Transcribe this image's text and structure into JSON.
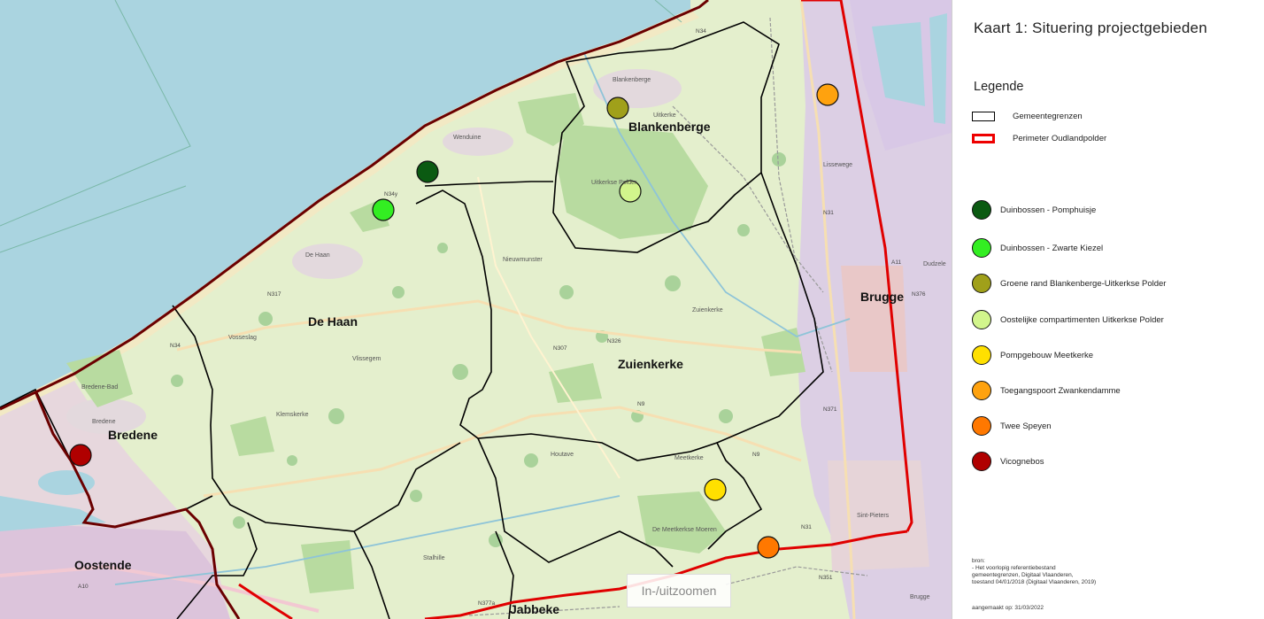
{
  "map": {
    "places": {
      "blankenberge": "Blankenberge",
      "de_haan": "De Haan",
      "zuienkerke": "Zuienkerke",
      "bredene": "Bredene",
      "brugge": "Brugge",
      "oostende": "Oostende",
      "jabbeke": "Jabbeke"
    },
    "small_labels": {
      "wenduine": "Wenduine",
      "uitkerke": "Uitkerke",
      "de_haan_small": "De Haan",
      "nieuwmunster": "Nieuwmunster",
      "vosseslag": "Vosseslag",
      "vlissegem": "Vlissegem",
      "klemskerke": "Klemskerke",
      "bredene_bad": "Bredene-Bad",
      "bredene_small": "Bredene",
      "houtave": "Houtave",
      "meetkerke": "Meetkerke",
      "zuienkerke_small": "Zuienkerke",
      "lissewege": "Lissewege",
      "stalhille": "Stalhille",
      "sint_pieters": "Sint-Pieters",
      "brugge_small": "Brugge",
      "blankenberge_small": "Blankenberge",
      "uitkerkse_polder": "Uitkerkse Polder",
      "meetkerkse_moeren": "De Meetkerkse Moeren",
      "dudzele": "Dudzele"
    },
    "roads": {
      "n34": "N34",
      "n34y": "N34y",
      "n317": "N317",
      "n307": "N307",
      "n326": "N326",
      "n9": "N9",
      "n31": "N31",
      "n371": "N371",
      "n351": "N351",
      "n376": "N376",
      "a10": "A10",
      "a11": "A11",
      "n377a": "N377a"
    },
    "zoom_button": "In-/uitzoomen"
  },
  "panel": {
    "title": "Kaart 1: Situering projectgebieden",
    "legend_heading": "Legende",
    "boundary_items": [
      {
        "label": "Gemeentegrenzen",
        "color": "#000000"
      },
      {
        "label": "Perimeter Oudlandpolder",
        "color": "#e00000"
      }
    ],
    "project_items": [
      {
        "label": "Duinbossen - Pomphuisje",
        "color": "#0b5a12"
      },
      {
        "label": "Duinbossen - Zwarte Kiezel",
        "color": "#33ee22"
      },
      {
        "label": "Groene rand Blankenberge-Uitkerkse Polder",
        "color": "#a0a01a"
      },
      {
        "label": "Oostelijke compartimenten Uitkerkse Polder",
        "color": "#d2f58c"
      },
      {
        "label": "Pompgebouw Meetkerke",
        "color": "#ffe000"
      },
      {
        "label": "Toegangspoort Zwankendamme",
        "color": "#ffa20e"
      },
      {
        "label": "Twee Speyen",
        "color": "#ff7800"
      },
      {
        "label": "Vicognebos",
        "color": "#b00000"
      }
    ],
    "source": {
      "l1": "bron:",
      "l2": "- Het voorlopig referentiebestand",
      "l3": "  gemeentegrenzen, Digitaal Vlaanderen,",
      "l4": "  toestand 04/01/2018  (Digitaal Vlaanderen, 2019)"
    },
    "made": "aangemaakt op: 31/03/2022"
  }
}
